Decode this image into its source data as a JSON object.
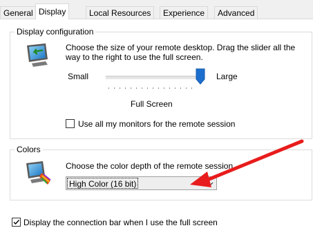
{
  "tabs": [
    {
      "label": "General",
      "active": false
    },
    {
      "label": "Display",
      "active": true
    },
    {
      "label": "Local Resources",
      "active": false
    },
    {
      "label": "Experience",
      "active": false
    },
    {
      "label": "Advanced",
      "active": false
    }
  ],
  "display_config": {
    "legend": "Display configuration",
    "icon": "monitor-resize-icon",
    "description": "Choose the size of your remote desktop. Drag the slider all the way to the right to use the full screen.",
    "description_line1": "Choose the size of your remote desktop. Drag the slider all the",
    "description_line2": "way to the right to use the full screen.",
    "slider_min_label": "Small",
    "slider_max_label": "Large",
    "slider_value_fraction": 1.0,
    "slider_value_label": "Full Screen",
    "use_all_monitors_label": "Use all my monitors for the remote session",
    "use_all_monitors_checked": false
  },
  "colors": {
    "legend": "Colors",
    "icon": "monitor-color-icon",
    "description": "Choose the color depth of the remote session.",
    "selected_depth": "High Color (16 bit)"
  },
  "connection_bar": {
    "label": "Display the connection bar when I use the full screen",
    "checked": true
  },
  "annotation": {
    "icon": "red-arrow-icon",
    "color": "#e81c1c"
  },
  "theme": {
    "slider_thumb_color": "#1d6fcf",
    "tab_background": "#f0f0f0"
  }
}
